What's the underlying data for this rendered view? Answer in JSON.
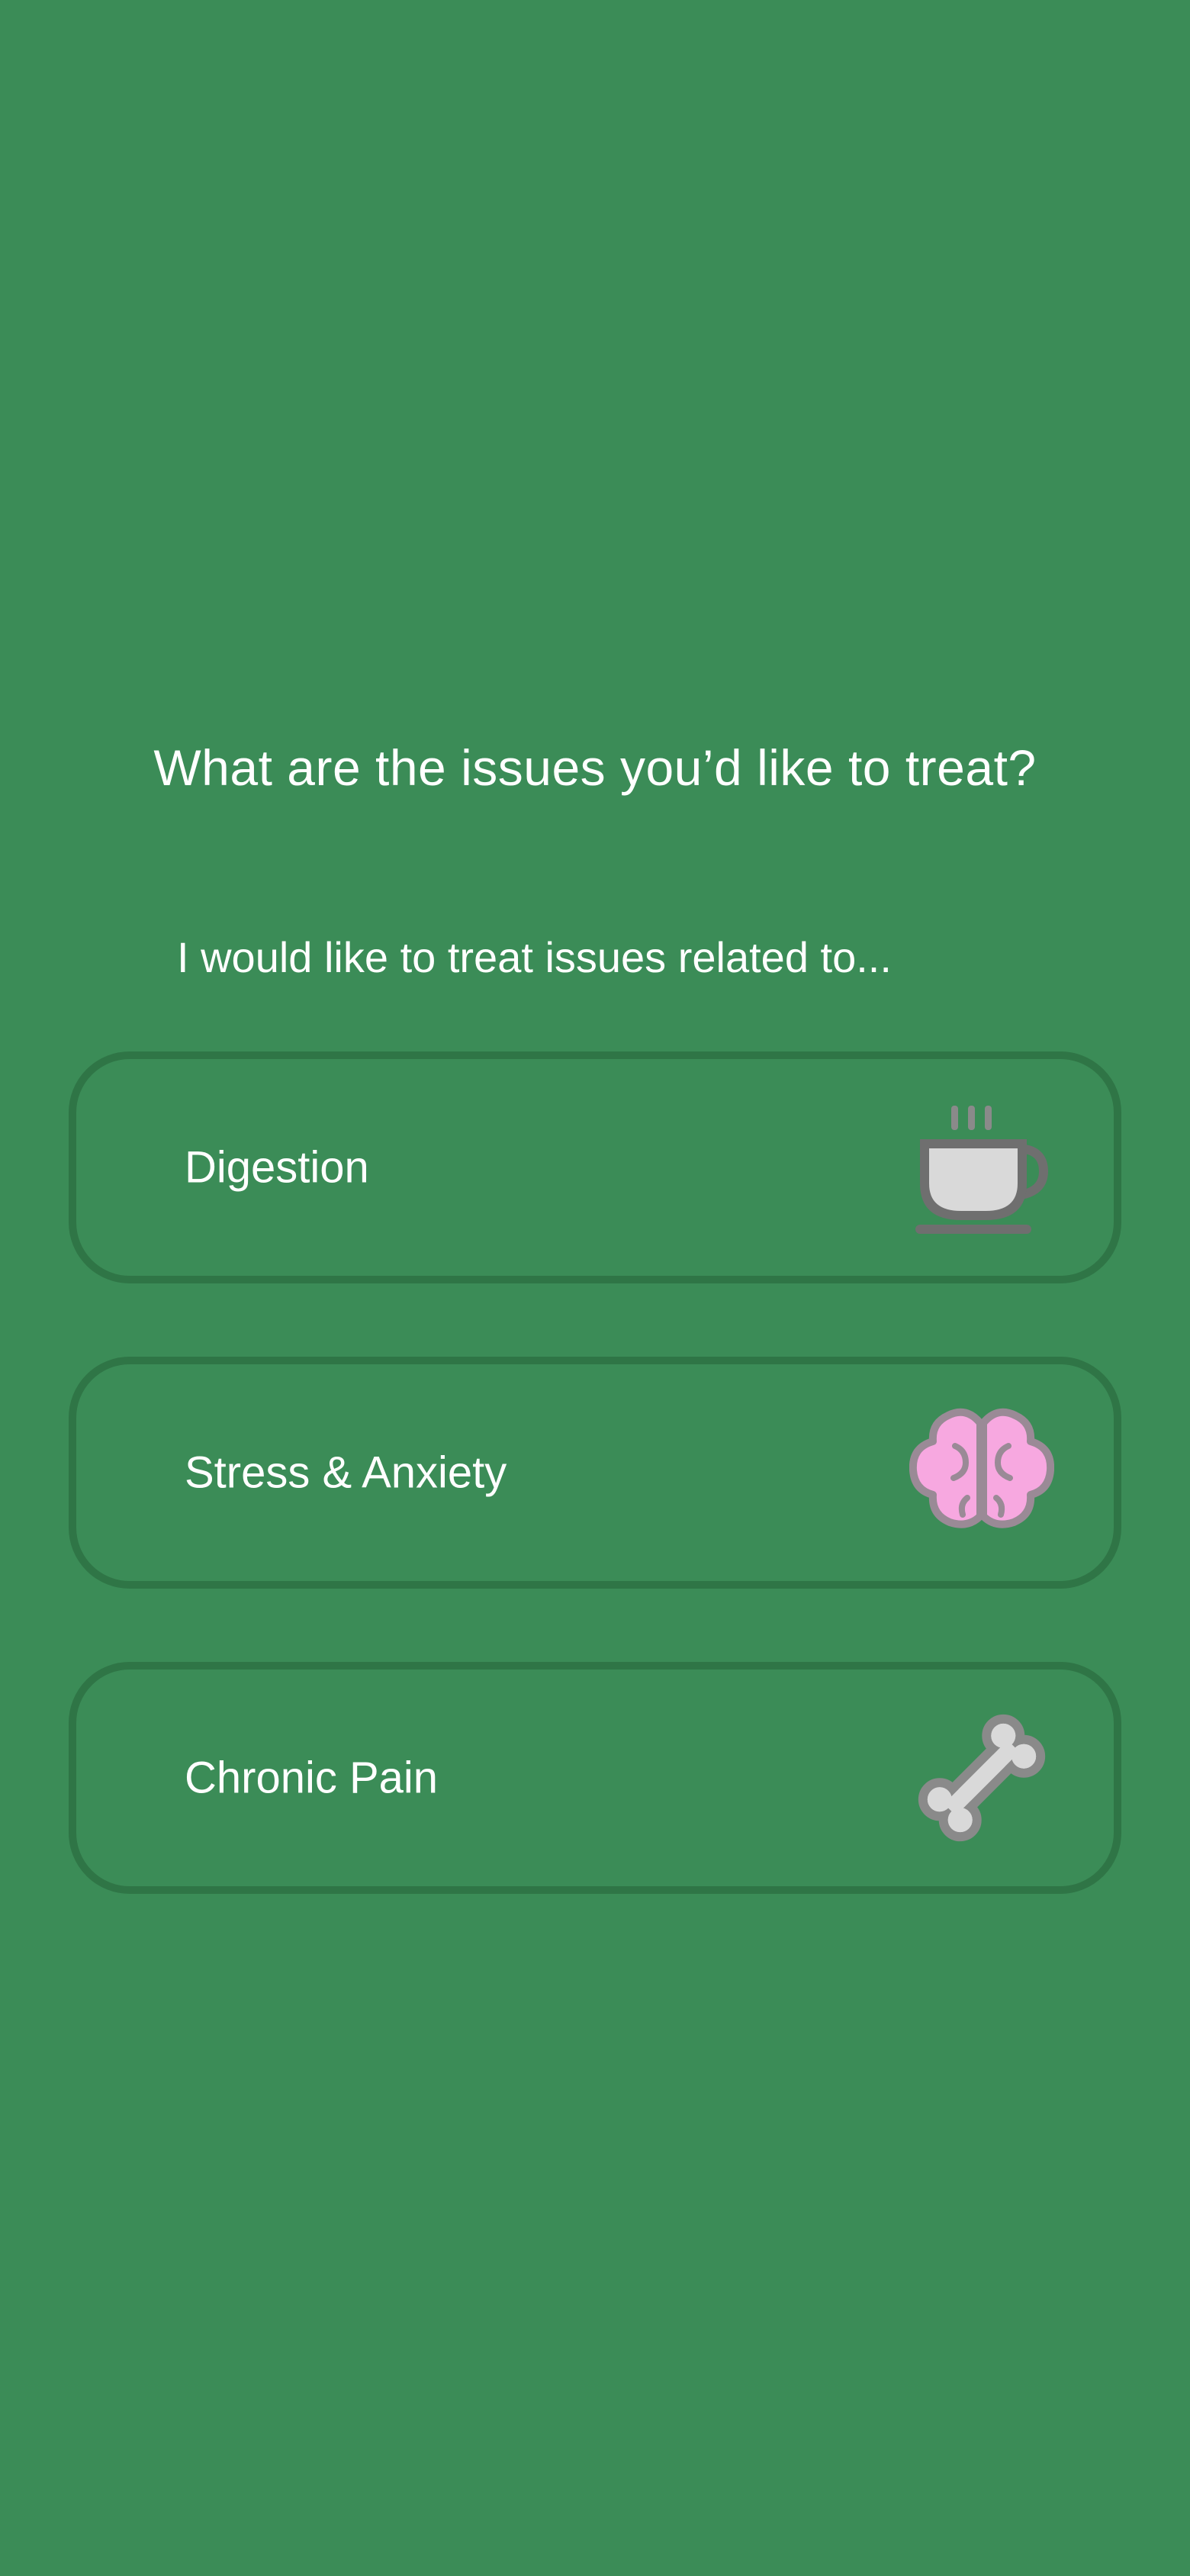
{
  "header": {
    "question": "What are the issues you’d like to treat?",
    "prompt": "I would like to treat issues related to..."
  },
  "options": [
    {
      "label": "Digestion",
      "icon": "coffee-cup-icon"
    },
    {
      "label": "Stress & Anxiety",
      "icon": "brain-icon"
    },
    {
      "label": "Chronic Pain",
      "icon": "bone-icon"
    }
  ],
  "colors": {
    "background": "#3b8c57",
    "card_border": "#2f7546",
    "text": "#ffffff",
    "brain": "#f7a8e0",
    "icon_gray": "#d9d9d9",
    "icon_outline": "#7a7a7a"
  }
}
